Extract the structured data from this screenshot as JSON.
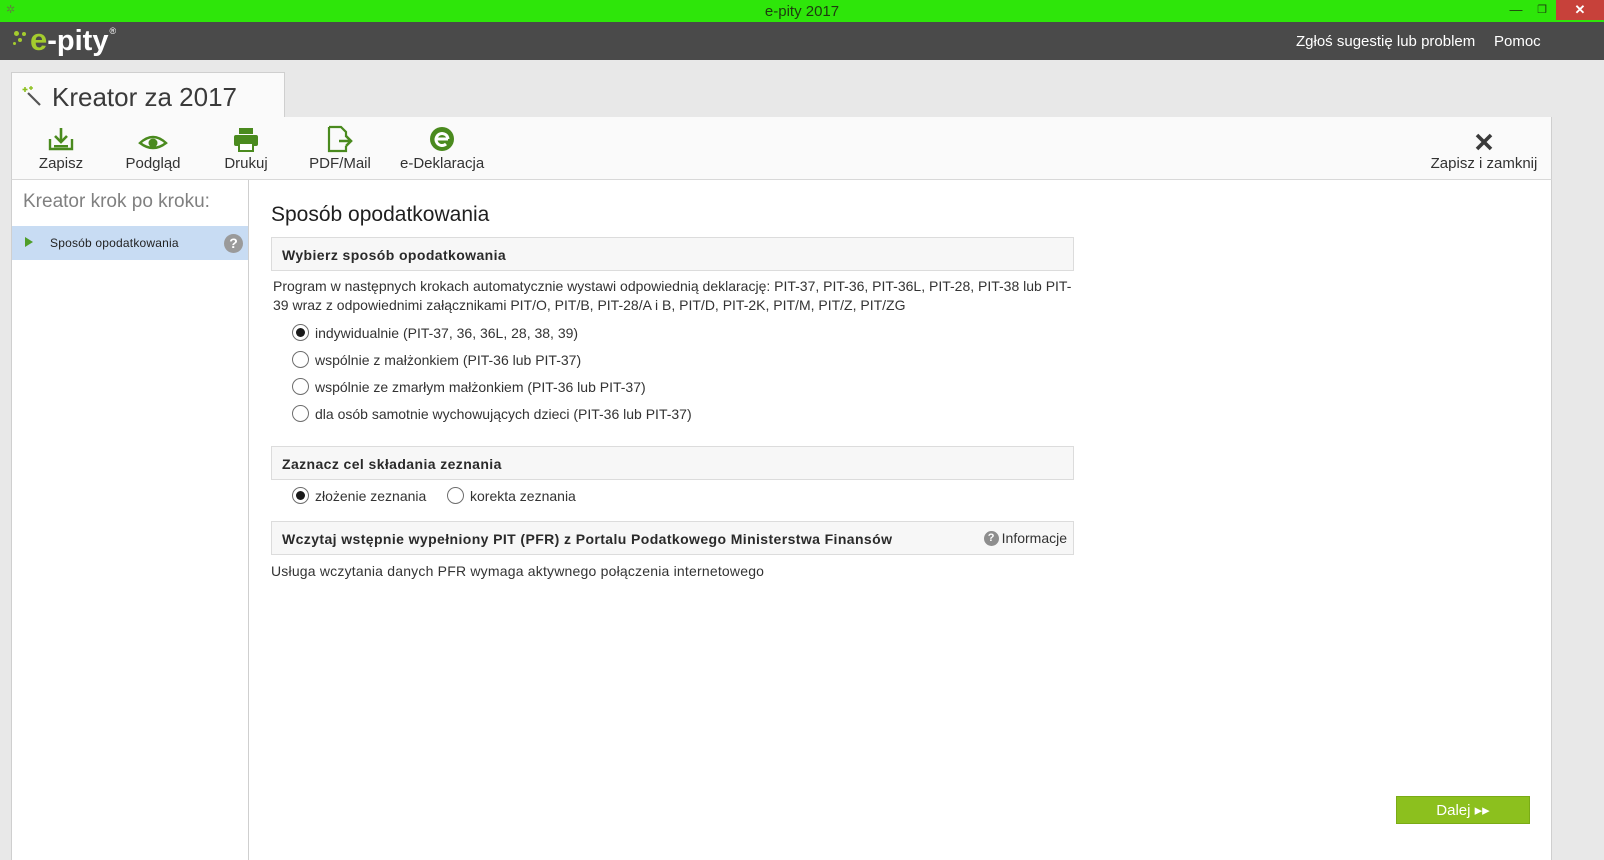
{
  "window": {
    "title": "e-pity 2017",
    "minimize_glyph": "—",
    "maximize_glyph": "❐",
    "close_glyph": "✕"
  },
  "header": {
    "logo": {
      "e": "e",
      "rest": "-pity",
      "reg": "®"
    },
    "links": [
      "Zgłoś sugestię lub problem",
      "Pomoc"
    ]
  },
  "tab": {
    "title": "Kreator za 2017",
    "icon": "wand-icon"
  },
  "toolbar": {
    "buttons": [
      {
        "label": "Zapisz",
        "icon": "save-icon"
      },
      {
        "label": "Podgląd",
        "icon": "eye-icon"
      },
      {
        "label": "Drukuj",
        "icon": "printer-icon"
      },
      {
        "label": "PDF/Mail",
        "icon": "pdf-export-icon"
      },
      {
        "label": "e-Deklaracja",
        "icon": "e-declaration-icon"
      }
    ],
    "save_close_label": "Zapisz i zamknij",
    "save_close_icon": "close-x-icon"
  },
  "sidebar": {
    "title": "Kreator krok po kroku:",
    "steps": [
      {
        "label": "Sposób opodatkowania",
        "help": "?"
      }
    ]
  },
  "main": {
    "title": "Sposób opodatkowania",
    "section1": {
      "title": "Wybierz sposób opodatkowania",
      "description": "Program w następnych krokach automatycznie wystawi odpowiednią deklarację: PIT-37, PIT-36, PIT-36L, PIT-28, PIT-38 lub PIT-39 wraz z odpowiednimi załącznikami PIT/O, PIT/B, PIT-28/A i B, PIT/D, PIT-2K, PIT/M, PIT/Z, PIT/ZG",
      "options": [
        {
          "label": "indywidualnie (PIT-37, 36, 36L, 28, 38, 39)",
          "checked": true
        },
        {
          "label": "wspólnie z małżonkiem (PIT-36 lub PIT-37)",
          "checked": false
        },
        {
          "label": "wspólnie ze zmarłym małżonkiem (PIT-36 lub PIT-37)",
          "checked": false
        },
        {
          "label": "dla osób samotnie wychowujących dzieci (PIT-36 lub PIT-37)",
          "checked": false
        }
      ]
    },
    "section2": {
      "title": "Zaznacz cel składania zeznania",
      "options": [
        {
          "label": "złożenie zeznania",
          "checked": true
        },
        {
          "label": "korekta zeznania",
          "checked": false
        }
      ]
    },
    "section3": {
      "title": "Wczytaj wstępnie wypełniony PIT (PFR) z Portalu Podatkowego Ministerstwa Finansów",
      "info_label": "Informacje",
      "info_icon_glyph": "?",
      "note": "Usługa wczytania danych PFR wymaga aktywnego połączenia internetowego"
    },
    "next_button": "Dalej ▸▸"
  },
  "colors": {
    "titlebar": "#2ee60a",
    "header": "#4a4a4a",
    "accent_green": "#8cc01e",
    "selected_step": "#c8dcf3"
  }
}
